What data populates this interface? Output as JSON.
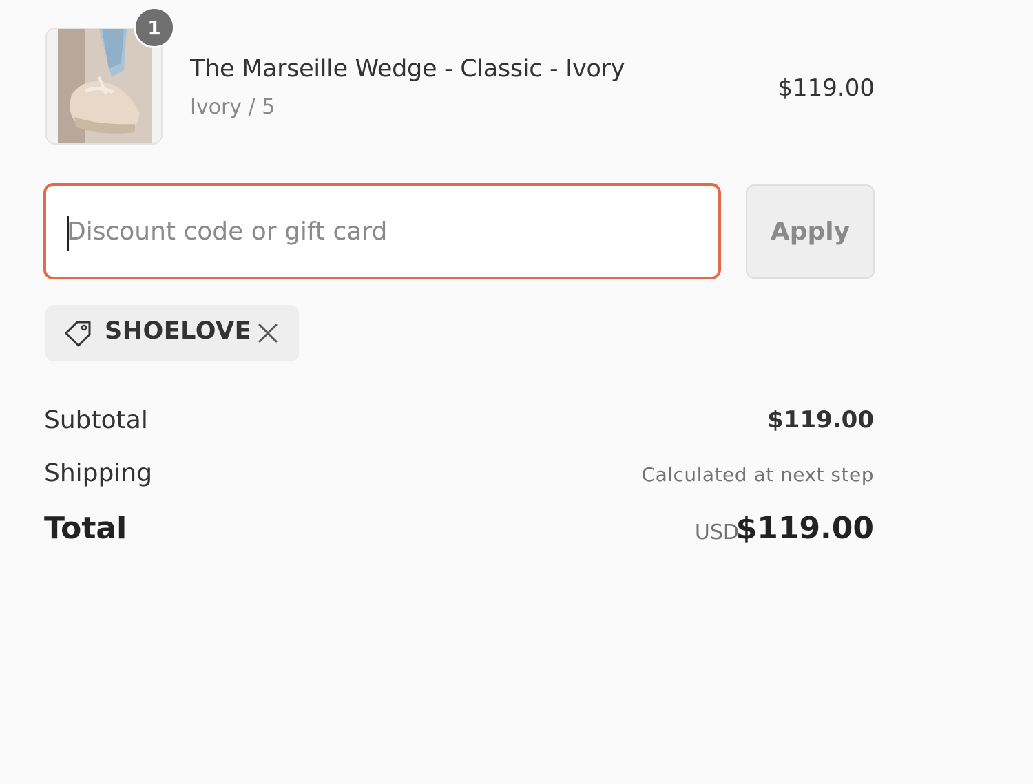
{
  "product": {
    "quantity_badge": "1",
    "name": "The Marseille Wedge - Classic - Ivory",
    "variant": "Ivory / 5",
    "price": "$119.00",
    "image_icon": "shoe-photo"
  },
  "discount": {
    "placeholder": "Discount code or gift card",
    "value": "",
    "apply_label": "Apply",
    "border_color": "#e36b4a"
  },
  "applied_code": {
    "icon": "tag-icon",
    "code": "SHOELOVE",
    "remove_icon": "close-icon"
  },
  "summary": {
    "subtotal_label": "Subtotal",
    "subtotal_value": "$119.00",
    "shipping_label": "Shipping",
    "shipping_value": "Calculated at next step",
    "total_label": "Total",
    "total_currency": "USD",
    "total_value": "$119.00"
  }
}
